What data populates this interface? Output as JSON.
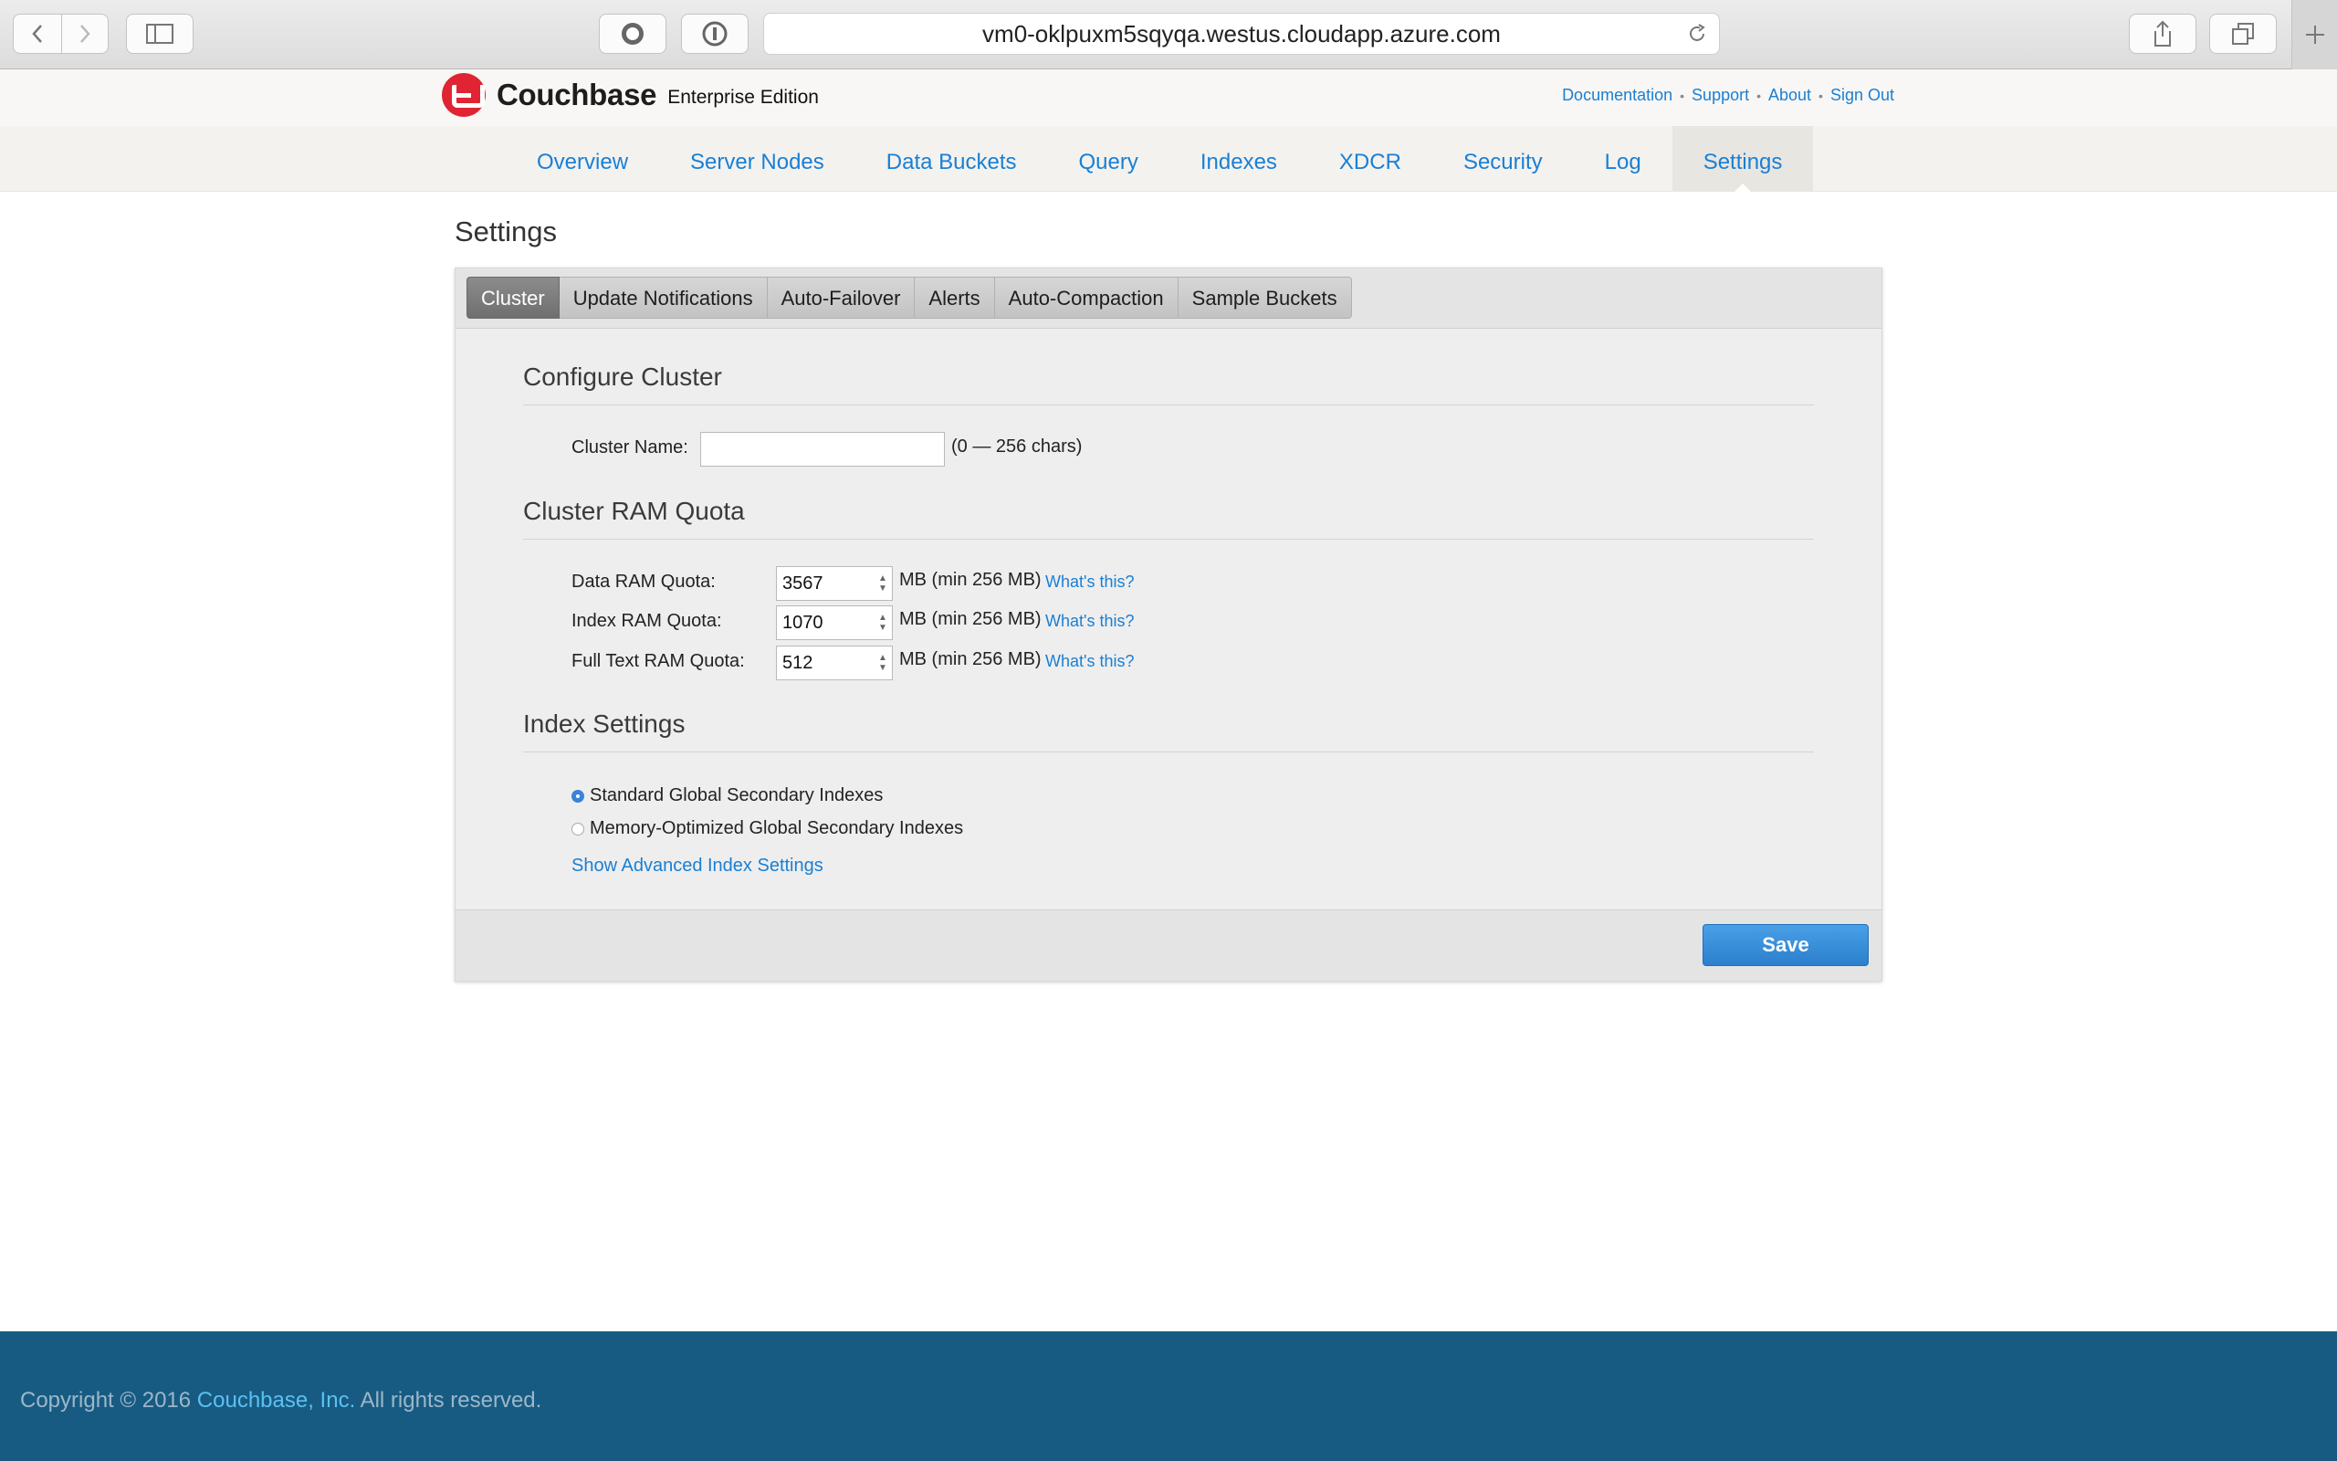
{
  "browser": {
    "url": "vm0-oklpuxm5sqyqa.westus.cloudapp.azure.com"
  },
  "header": {
    "brand": "Couchbase",
    "edition": "Enterprise Edition",
    "links": [
      "Documentation",
      "Support",
      "About",
      "Sign Out"
    ]
  },
  "nav": {
    "items": [
      "Overview",
      "Server Nodes",
      "Data Buckets",
      "Query",
      "Indexes",
      "XDCR",
      "Security",
      "Log",
      "Settings"
    ],
    "active": "Settings"
  },
  "page": {
    "title": "Settings"
  },
  "tabs": {
    "items": [
      "Cluster",
      "Update Notifications",
      "Auto-Failover",
      "Alerts",
      "Auto-Compaction",
      "Sample Buckets"
    ],
    "active": "Cluster"
  },
  "configure_cluster": {
    "heading": "Configure Cluster",
    "cluster_name_label": "Cluster Name:",
    "cluster_name_value": "",
    "cluster_name_hint": "(0 — 256 chars)"
  },
  "ram_quota": {
    "heading": "Cluster RAM Quota",
    "rows": [
      {
        "label": "Data RAM Quota:",
        "value": "3567",
        "unit": "MB (min 256 MB)",
        "help": "What's this?"
      },
      {
        "label": "Index RAM Quota:",
        "value": "1070",
        "unit": "MB (min 256 MB)",
        "help": "What's this?"
      },
      {
        "label": "Full Text RAM Quota:",
        "value": "512",
        "unit": "MB (min 256 MB)",
        "help": "What's this?"
      }
    ]
  },
  "index_settings": {
    "heading": "Index Settings",
    "options": [
      "Standard Global Secondary Indexes",
      "Memory-Optimized Global Secondary Indexes"
    ],
    "selected": "Standard Global Secondary Indexes",
    "advanced_link": "Show Advanced Index Settings"
  },
  "actions": {
    "save": "Save"
  },
  "footer": {
    "prefix": "Copyright © 2016 ",
    "company": "Couchbase, Inc.",
    "suffix": " All rights reserved."
  }
}
